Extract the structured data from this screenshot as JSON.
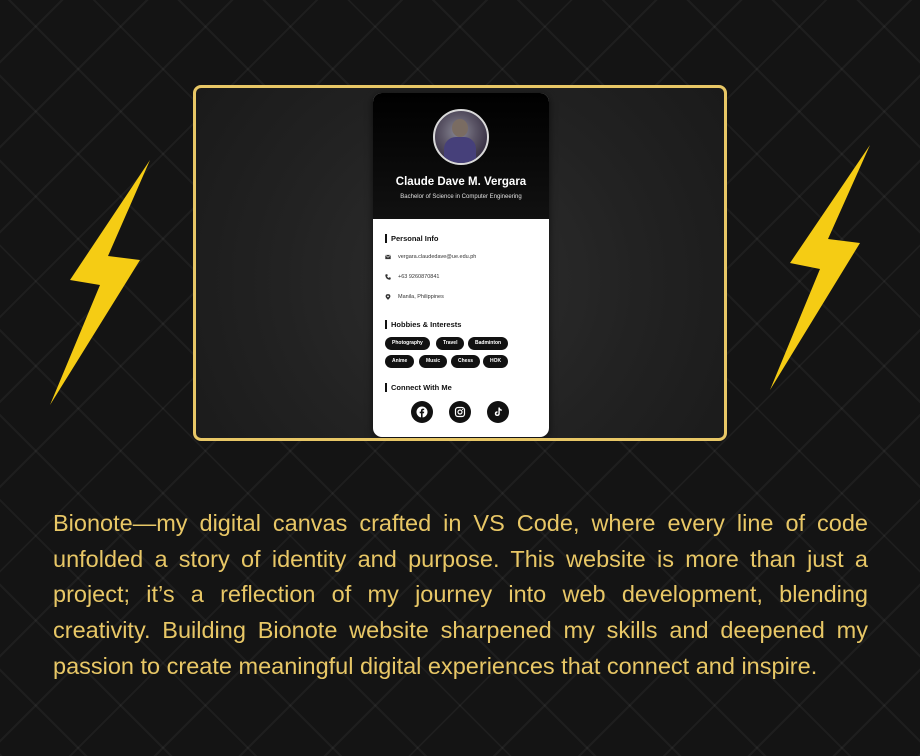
{
  "card": {
    "name": "Claude Dave M. Vergara",
    "degree": "Bachelor of Science in Computer Engineering",
    "personal_info": {
      "title": "Personal Info",
      "email": "vergara.claudedave@ue.edu.ph",
      "phone": "+63 9260870841",
      "location": "Manila, Philippines"
    },
    "hobbies": {
      "title": "Hobbies & Interests",
      "tags": [
        "Photography",
        "Travel",
        "Badminton",
        "Anime",
        "Music",
        "Chess",
        "HOK"
      ]
    },
    "connect": {
      "title": "Connect With Me",
      "icons": [
        "facebook-icon",
        "instagram-icon",
        "tiktok-icon"
      ]
    }
  },
  "bio": "Bionote—my digital canvas crafted in VS Code, where every line of code unfolded a story of identity and purpose. This website is more than just a project; it’s a reflection of my journey into web development, blending creativity. Building Bionote website sharpened my skills and deepened my passion to create meaningful digital experiences that connect and inspire.",
  "colors": {
    "accent": "#e8c766",
    "bolt": "#f5cc14",
    "card_header": "#000000",
    "tag_bg": "#111111"
  }
}
